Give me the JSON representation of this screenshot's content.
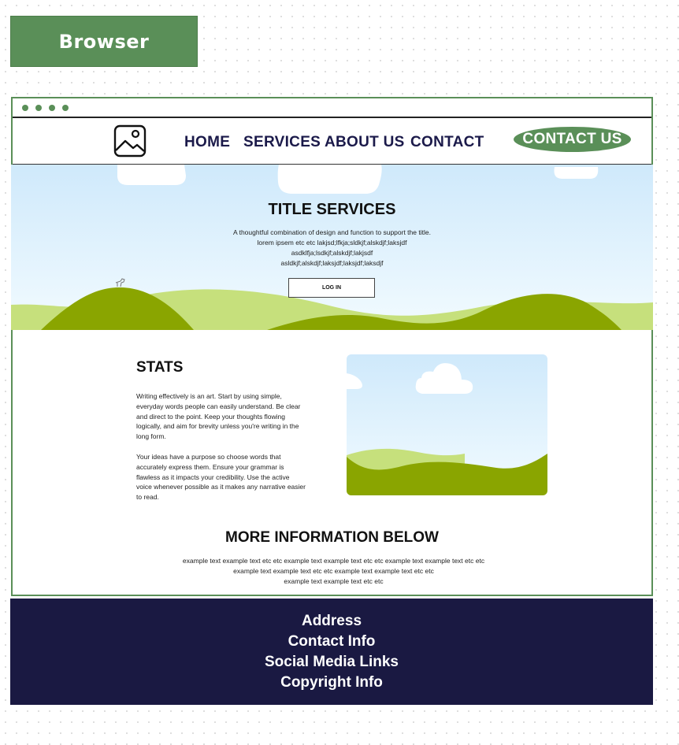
{
  "label": {
    "text": "Browser"
  },
  "colors": {
    "accent": "#5a8f58",
    "navy": "#1b1a4a",
    "footer": "#1a1942",
    "sky": "#d7eefc",
    "hill_dark": "#8aa500",
    "hill_light": "#c6e07c"
  },
  "browser": {
    "dots": 4
  },
  "navbar": {
    "logo": "image-placeholder-icon",
    "items": [
      {
        "label": "HOME"
      },
      {
        "label": "SERVICES"
      },
      {
        "label": "ABOUT US"
      },
      {
        "label": "CONTACT"
      }
    ],
    "cta": "CONTACT US"
  },
  "hero": {
    "title": "TITLE SERVICES",
    "lines": [
      "A thoughtful combination of design and function to support the title.",
      "lorem ipsem etc etc lakjsd;lfkja;sldkjf;alskdjf;laksjdf",
      "asdklfja;lsdkjf;alskdjf;lakjsdf",
      "asldkjf;alskdjf;laksjdf;laksjdf;laksdjf"
    ],
    "button": "LOG IN"
  },
  "stats": {
    "title": "STATS",
    "para1": "Writing effectively is an art. Start by using simple, everyday words people can easily understand. Be clear and direct to the point. Keep your thoughts flowing logically, and aim for brevity unless you're writing in the long form.",
    "para2": "Your ideas have a purpose so choose words that accurately express them. Ensure your grammar is flawless as it impacts your credibility. Use the active voice whenever possible as it makes any narrative easier to read."
  },
  "more": {
    "title": "MORE INFORMATION BELOW",
    "lines": [
      "example text example text etc etc example text example text etc etc example text example text etc etc",
      "example text example text etc etc example text example text etc etc",
      "example text example text etc etc"
    ]
  },
  "footer": {
    "items": [
      "Address",
      "Contact Info",
      "Social Media Links",
      "Copyright Info"
    ]
  }
}
